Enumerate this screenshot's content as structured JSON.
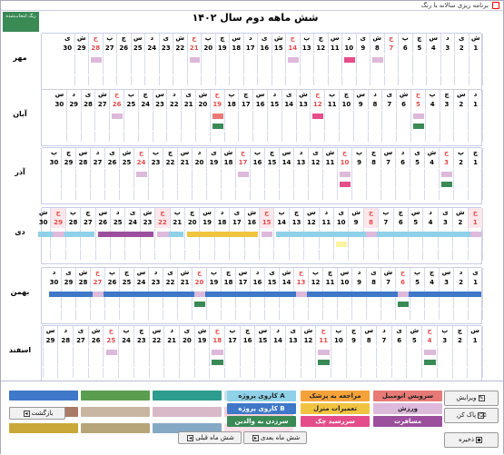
{
  "window": {
    "title": "برنامه ریزی سالانه با رنگ"
  },
  "title": "شش ماهه دوم سال ۱۴۰۲",
  "color_button": "رنگ انتخاب‌شده",
  "months": [
    {
      "name": "مهر",
      "days": [
        "ش",
        "ی",
        "د",
        "س",
        "چ",
        "پ",
        "ج",
        "ش",
        "ی",
        "د",
        "س",
        "چ",
        "پ",
        "ج",
        "ش",
        "ی",
        "د",
        "س",
        "چ",
        "پ",
        "ج",
        "ش",
        "ی",
        "د",
        "س",
        "چ",
        "پ",
        "ج",
        "ش",
        "ی"
      ],
      "nums": [
        "1",
        "2",
        "3",
        "4",
        "5",
        "6",
        "7",
        "8",
        "9",
        "10",
        "11",
        "12",
        "13",
        "14",
        "15",
        "16",
        "17",
        "18",
        "19",
        "20",
        "21",
        "22",
        "23",
        "24",
        "25",
        "26",
        "27",
        "28",
        "29",
        "30"
      ],
      "red": [
        7,
        14,
        21,
        28
      ],
      "holiday": [],
      "events": [
        [
          8,
          "#ddb9db"
        ],
        [
          10,
          "#e44d89"
        ],
        [
          14,
          "#ddb9db"
        ],
        [
          21,
          "#ddb9db"
        ],
        [
          28,
          "#ddb9db"
        ]
      ],
      "row2": []
    },
    {
      "name": "آبان",
      "days": [
        "د",
        "س",
        "چ",
        "پ",
        "ج",
        "ش",
        "ی",
        "د",
        "س",
        "چ",
        "پ",
        "ج",
        "ش",
        "ی",
        "د",
        "س",
        "چ",
        "پ",
        "ج",
        "ش",
        "ی",
        "د",
        "س",
        "چ",
        "پ",
        "ج",
        "ش",
        "ی",
        "د",
        "س"
      ],
      "nums": [
        "1",
        "2",
        "3",
        "4",
        "5",
        "6",
        "7",
        "8",
        "9",
        "10",
        "11",
        "12",
        "13",
        "14",
        "15",
        "16",
        "17",
        "18",
        "19",
        "20",
        "21",
        "22",
        "23",
        "24",
        "25",
        "26",
        "27",
        "28",
        "29",
        "30"
      ],
      "red": [
        5,
        12,
        19,
        26
      ],
      "holiday": [],
      "events": [
        [
          5,
          "#ddb9db"
        ],
        [
          12,
          "#e44d89"
        ],
        [
          19,
          "#e77a76"
        ],
        [
          26,
          "#ddb9db"
        ]
      ],
      "row2": [
        [
          5,
          "#3a8a55"
        ],
        [
          19,
          "#3a8a55"
        ]
      ]
    },
    {
      "name": "آذر",
      "days": [
        "چ",
        "پ",
        "ج",
        "ش",
        "ی",
        "د",
        "س",
        "چ",
        "پ",
        "ج",
        "ش",
        "ی",
        "د",
        "س",
        "چ",
        "پ",
        "ج",
        "ش",
        "ی",
        "د",
        "س",
        "چ",
        "پ",
        "ج",
        "ش",
        "ی",
        "د",
        "س",
        "چ",
        "پ"
      ],
      "nums": [
        "1",
        "2",
        "3",
        "4",
        "5",
        "6",
        "7",
        "8",
        "9",
        "10",
        "11",
        "12",
        "13",
        "14",
        "15",
        "16",
        "17",
        "18",
        "19",
        "20",
        "21",
        "22",
        "23",
        "24",
        "25",
        "26",
        "27",
        "28",
        "29",
        "30"
      ],
      "red": [
        3,
        10,
        17,
        24
      ],
      "holiday": [],
      "events": [
        [
          3,
          "#ddb9db"
        ],
        [
          10,
          "#ddb9db"
        ],
        [
          17,
          "#ddb9db"
        ],
        [
          24,
          "#ddb9db"
        ]
      ],
      "row2": [
        [
          3,
          "#3a8a55"
        ],
        [
          10,
          "#e44d89"
        ]
      ]
    },
    {
      "name": "دی",
      "days": [
        "ج",
        "ش",
        "ی",
        "د",
        "س",
        "چ",
        "پ",
        "ج",
        "ش",
        "ی",
        "د",
        "س",
        "چ",
        "پ",
        "ج",
        "ش",
        "ی",
        "د",
        "س",
        "چ",
        "پ",
        "ج",
        "ش",
        "ی",
        "د",
        "س",
        "چ",
        "پ",
        "ج",
        "ش"
      ],
      "nums": [
        "1",
        "2",
        "3",
        "4",
        "5",
        "6",
        "7",
        "8",
        "9",
        "10",
        "11",
        "12",
        "13",
        "14",
        "15",
        "16",
        "17",
        "18",
        "19",
        "20",
        "21",
        "22",
        "23",
        "24",
        "25",
        "26",
        "27",
        "28",
        "29",
        "30"
      ],
      "red": [
        1,
        8,
        15,
        22,
        29
      ],
      "holiday": [
        1,
        8,
        15,
        22,
        29
      ],
      "events": [
        [
          1,
          "#ddb9db"
        ],
        [
          8,
          "#ddb9db"
        ],
        [
          15,
          "#ddb9db"
        ],
        [
          22,
          "#ddb9db"
        ],
        [
          29,
          "#ddb9db"
        ]
      ],
      "row2": [],
      "bands": [
        [
          1,
          14,
          "#8ed1e8"
        ],
        [
          15,
          15,
          "#8ed1e8"
        ],
        [
          16,
          20,
          "#f0c341"
        ],
        [
          21,
          22,
          "#8ed1e8"
        ],
        [
          23,
          26,
          "#9b4f9d"
        ],
        [
          27,
          30,
          "#8ed1e8"
        ]
      ],
      "extra": [
        [
          10,
          "#fbf3a0"
        ]
      ]
    },
    {
      "name": "بهمن",
      "days": [
        "ی",
        "د",
        "س",
        "چ",
        "پ",
        "ج",
        "ش",
        "ی",
        "د",
        "س",
        "چ",
        "پ",
        "ج",
        "ش",
        "ی",
        "د",
        "س",
        "چ",
        "پ",
        "ج",
        "ش",
        "ی",
        "د",
        "س",
        "چ",
        "پ",
        "ج",
        "ش",
        "ی",
        "د"
      ],
      "nums": [
        "1",
        "2",
        "3",
        "4",
        "5",
        "6",
        "7",
        "8",
        "9",
        "10",
        "11",
        "12",
        "13",
        "14",
        "15",
        "16",
        "17",
        "18",
        "19",
        "20",
        "21",
        "22",
        "23",
        "24",
        "25",
        "26",
        "27",
        "28",
        "29",
        "30"
      ],
      "red": [
        6,
        13,
        20,
        27
      ],
      "holiday": [],
      "events": [
        [
          6,
          "#ddb9db"
        ],
        [
          13,
          "#ddb9db"
        ],
        [
          20,
          "#ddb9db"
        ],
        [
          27,
          "#ddb9db"
        ]
      ],
      "row2": [
        [
          6,
          "#3a8a55"
        ],
        [
          20,
          "#3a8a55"
        ]
      ],
      "bands": [
        [
          1,
          30,
          "#3f78c8"
        ]
      ]
    },
    {
      "name": "اسفند",
      "days": [
        "س",
        "چ",
        "پ",
        "ج",
        "ش",
        "ی",
        "د",
        "س",
        "چ",
        "پ",
        "ج",
        "ش",
        "ی",
        "د",
        "س",
        "چ",
        "پ",
        "ج",
        "ش",
        "ی",
        "د",
        "س",
        "چ",
        "پ",
        "ج",
        "ش",
        "ی",
        "د",
        "س",
        ""
      ],
      "nums": [
        "1",
        "2",
        "3",
        "4",
        "5",
        "6",
        "7",
        "8",
        "9",
        "10",
        "11",
        "12",
        "13",
        "14",
        "15",
        "16",
        "17",
        "18",
        "19",
        "20",
        "21",
        "22",
        "23",
        "24",
        "25",
        "26",
        "27",
        "28",
        "29",
        ""
      ],
      "red": [
        4,
        11,
        18,
        25
      ],
      "holiday": [],
      "events": [
        [
          4,
          "#ddb9db"
        ],
        [
          11,
          "#ddb9db"
        ],
        [
          18,
          "#ddb9db"
        ],
        [
          25,
          "#ddb9db"
        ]
      ],
      "row2": [
        [
          4,
          "#3a8a55"
        ],
        [
          11,
          "#3a8a55"
        ],
        [
          18,
          "#3a8a55"
        ]
      ]
    }
  ],
  "colors": {
    "red": "#e34a4a",
    "pink": "#ddb9db",
    "magenta": "#e44d89",
    "salmon": "#e77a76",
    "green": "#3a8a55",
    "cyan": "#8ed1e8",
    "yellow": "#f0c341",
    "purple": "#9b4f9d",
    "blue": "#3f78c8"
  },
  "legend": [
    {
      "label": "سرویس اتومبیل",
      "color": "#e77a76"
    },
    {
      "label": "مراجعه به پزشک",
      "color": "#f5a23b"
    },
    {
      "label": "کاروی پروژه A",
      "color": "#8ed1e8"
    },
    {
      "label": "ورزش",
      "color": "#ddb9db"
    },
    {
      "label": "تعمیرات منزل",
      "color": "#f0c341"
    },
    {
      "label": "کاروی پروژه B",
      "color": "#3f78c8"
    },
    {
      "label": "مسافرت",
      "color": "#9b4f9d"
    },
    {
      "label": "سررسید چک",
      "color": "#e44d89"
    },
    {
      "label": "سرزدن به والدین",
      "color": "#3a8a55"
    }
  ],
  "palette": [
    [
      "#3f78c8",
      "#5a9d4e",
      "#2e9c8e",
      "#cde0ec"
    ],
    [
      "#a97a66",
      "#c8b6a3",
      "#d7b9c8",
      "#f2cfd9"
    ],
    [
      "#c9a83a",
      "#b7a57a",
      "#85a8c4",
      "#fde0e8"
    ]
  ],
  "buttons": {
    "edit": "ویرایش",
    "clear": "پاک کن",
    "save": "ذخیره",
    "back": "بازگشت",
    "prev": "شش ماه قبلی",
    "next": "شش ماه بعدی"
  }
}
